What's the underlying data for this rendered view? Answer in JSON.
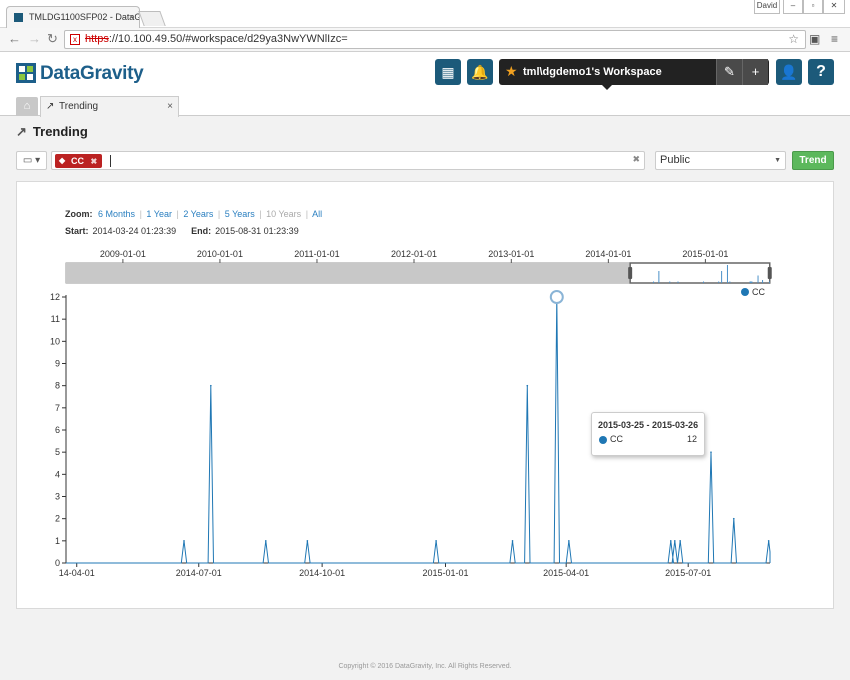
{
  "browser": {
    "tab_title": "TMLDG1100SFP02 - DataG",
    "tab_close": "×",
    "user_badge": "David",
    "win_min": "–",
    "win_max": "▫",
    "win_close": "✕",
    "nav_back": "←",
    "nav_forward": "→",
    "nav_reload": "↻",
    "url_protocol": "https",
    "url_rest": "://10.100.49.50/#workspace/d29ya3NwYWNlIzc=",
    "bookmark_icon": "☆",
    "menu_icon": "≡"
  },
  "app": {
    "logo_text": "DataGravity",
    "grid_icon": "▦",
    "bell_icon": "🔔",
    "workspace_name": "tml\\dgdemo1's Workspace",
    "edit_icon": "✎",
    "add_icon": "+",
    "user_icon": "👤",
    "help_icon": "?"
  },
  "page_tabs": {
    "home_icon": "⌂",
    "active_label": "Trending",
    "active_icon": "↗",
    "close": "×"
  },
  "page": {
    "title": "Trending",
    "title_icon": "↗",
    "book_button": "▭ ▾",
    "search_tag": "CC",
    "search_tag_icon": "◆",
    "search_tag_remove": "✖",
    "search_clear": "✖",
    "visibility": "Public",
    "visibility_caret": "▼",
    "trend_button": "Trend"
  },
  "zoom": {
    "label": "Zoom:",
    "options": [
      "6 Months",
      "1 Year",
      "2 Years",
      "5 Years",
      "10 Years",
      "All"
    ],
    "disabled": [
      "10 Years"
    ],
    "sep": "|"
  },
  "range": {
    "start_label": "Start:",
    "start": "2014-03-24 01:23:39",
    "end_label": "End:",
    "end": "2015-08-31 01:23:39"
  },
  "tooltip": {
    "range": "2015-03-25 - 2015-03-26",
    "series": "CC",
    "value": "12"
  },
  "footer": "Copyright © 2016 DataGravity, Inc. All Rights Reserved.",
  "chart_data": {
    "type": "line",
    "color": "#1f77b4",
    "series": [
      {
        "name": "CC",
        "points": [
          {
            "x": "2014-06-20",
            "y": 1
          },
          {
            "x": "2014-07-10",
            "y": 8
          },
          {
            "x": "2014-08-20",
            "y": 1
          },
          {
            "x": "2014-09-20",
            "y": 1
          },
          {
            "x": "2014-12-25",
            "y": 1
          },
          {
            "x": "2015-02-20",
            "y": 1
          },
          {
            "x": "2015-03-03",
            "y": 8
          },
          {
            "x": "2015-03-25",
            "y": 12
          },
          {
            "x": "2015-04-03",
            "y": 1
          },
          {
            "x": "2015-06-18",
            "y": 1
          },
          {
            "x": "2015-06-21",
            "y": 1
          },
          {
            "x": "2015-06-25",
            "y": 1
          },
          {
            "x": "2015-07-18",
            "y": 5
          },
          {
            "x": "2015-08-04",
            "y": 2
          },
          {
            "x": "2015-08-30",
            "y": 1
          }
        ]
      }
    ],
    "x_ticks": [
      "14-04-01",
      "2014-07-01",
      "2014-10-01",
      "2015-01-01",
      "2015-04-01",
      "2015-07-01"
    ],
    "y_ticks": [
      0,
      1,
      2,
      3,
      4,
      5,
      6,
      7,
      8,
      9,
      10,
      11,
      12
    ],
    "ylim": [
      0,
      12
    ],
    "xlim": [
      "2014-03-24",
      "2015-08-31"
    ],
    "highlight": {
      "x": "2015-03-25",
      "y": 12
    },
    "legend": {
      "position": "top-right",
      "entries": [
        "CC"
      ]
    },
    "navigator": {
      "ticks": [
        "2009-01-01",
        "2010-01-01",
        "2011-01-01",
        "2012-01-01",
        "2013-01-01",
        "2014-01-01",
        "2015-01-01"
      ],
      "range": [
        "2008-06-01",
        "2015-09-01"
      ],
      "selection": [
        "2014-03-24",
        "2015-08-31"
      ]
    }
  }
}
